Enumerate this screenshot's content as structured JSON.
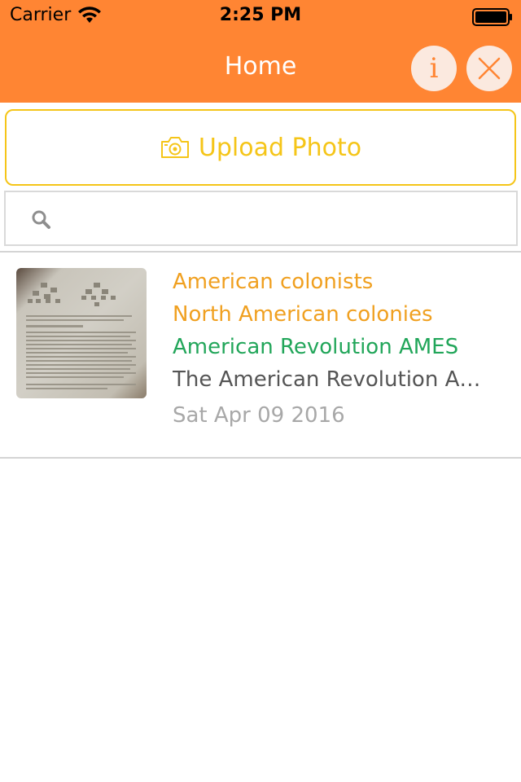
{
  "status_bar": {
    "carrier": "Carrier",
    "time": "2:25 PM"
  },
  "nav": {
    "title": "Home",
    "info_label": "i"
  },
  "upload": {
    "label": "Upload Photo",
    "icon": "camera-icon"
  },
  "search": {
    "icon": "search-icon",
    "placeholder": ""
  },
  "items": [
    {
      "keywords": [
        "American colonists",
        "North American colonies"
      ],
      "keyword_highlight": "American Revolution AMES",
      "snippet": "The American Revolution AMES",
      "date": "Sat Apr 09 2016"
    }
  ],
  "colors": {
    "header": "#ff8533",
    "accent_yellow": "#f5c518",
    "keyword_orange": "#f0a020",
    "keyword_green": "#22a65a"
  }
}
